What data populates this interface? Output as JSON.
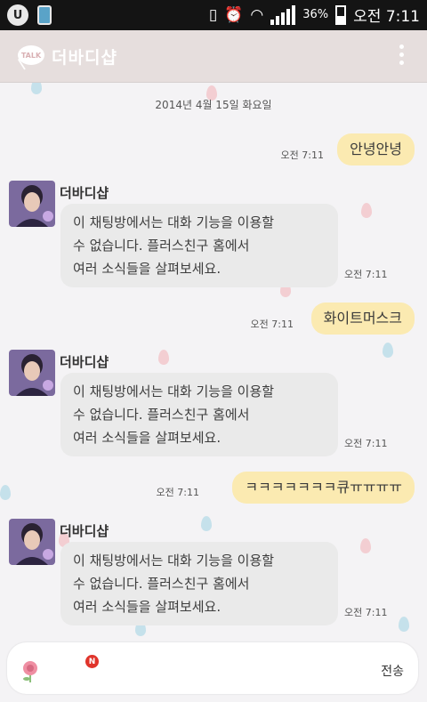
{
  "status_bar": {
    "battery_pct": "36%",
    "clock": "오전 7:11",
    "carrier_icon_letter": "U",
    "icons": [
      "u-plus-icon",
      "phone-icon",
      "vibrate-icon",
      "alarm-icon",
      "wifi-icon",
      "signal-icon",
      "battery-icon"
    ]
  },
  "header": {
    "logo_text": "TALK",
    "title": "더바디샵",
    "back_glyph": "〈"
  },
  "chat": {
    "date_divider": "2014년 4월 15일 화요일",
    "messages": [
      {
        "type": "out",
        "text": "안녕안녕",
        "time": "오전 7:11"
      },
      {
        "type": "in",
        "sender": "더바디샵",
        "lines": [
          "이 채팅방에서는 대화 기능을 이용할",
          "수 없습니다. 플러스친구 홈에서",
          "여러 소식들을 살펴보세요."
        ],
        "time": "오전 7:11"
      },
      {
        "type": "out",
        "text": "화이트머스크",
        "time": "오전 7:11"
      },
      {
        "type": "in",
        "sender": "더바디샵",
        "lines": [
          "이 채팅방에서는 대화 기능을 이용할",
          "수 없습니다. 플러스친구 홈에서",
          "여러 소식들을 살펴보세요."
        ],
        "time": "오전 7:11"
      },
      {
        "type": "out",
        "text": "ㅋㅋㅋㅋㅋㅋㅋ큐ㅠㅠㅠㅠ",
        "time": "오전 7:11"
      },
      {
        "type": "in",
        "sender": "더바디샵",
        "lines": [
          "이 채팅방에서는 대화 기능을 이용할",
          "수 없습니다. 플러스친구 홈에서",
          "여러 소식들을 살펴보세요."
        ],
        "time": "오전 7:11"
      }
    ]
  },
  "input_bar": {
    "send_label": "전송",
    "badge": "N",
    "value": ""
  },
  "colors": {
    "header_bg": "#e6dedd",
    "chat_bg": "#f4f3f5",
    "outgoing_bubble": "#fbeab1",
    "incoming_bubble": "#eaeaea",
    "badge": "#e0342b"
  }
}
